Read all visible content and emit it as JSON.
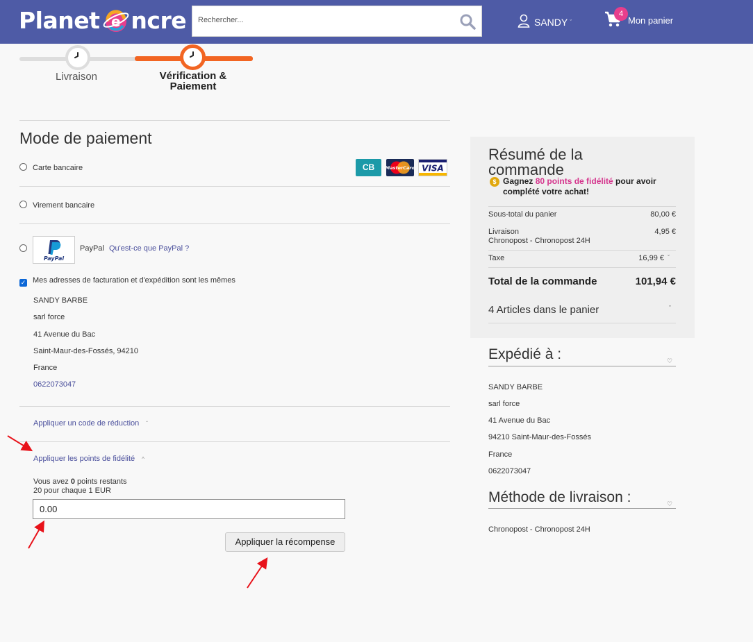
{
  "header": {
    "logo_text_left": "Planet",
    "logo_text_right": "ncre",
    "search_placeholder": "Rechercher...",
    "user_name": "SANDY",
    "user_caret": "ˇ",
    "cart_count": "4",
    "cart_label": "Mon panier",
    "colors": {
      "bar": "#4e5ba6",
      "badge": "#e83e8c"
    }
  },
  "steps": [
    {
      "label": "Livraison"
    },
    {
      "label": "Vérification & Paiement"
    }
  ],
  "payment": {
    "title": "Mode de paiement",
    "options": [
      "Carte bancaire",
      "Virement bancaire",
      "PayPal"
    ],
    "paypal_link": "Qu'est-ce que PayPal ?",
    "cards": [
      "CB",
      "MasterCard",
      "VISA"
    ],
    "same_address_label": "Mes adresses de facturation et d'expédition sont les mêmes",
    "same_address_checked": true
  },
  "billing_address": [
    "SANDY BARBE",
    "sarl force",
    "41 Avenue du Bac",
    "Saint-Maur-des-Fossés, 94210",
    "France",
    "0622073047"
  ],
  "discount": {
    "coupon_label": "Appliquer un code de réduction",
    "points_label": "Appliquer les points de fidélité",
    "points_prefix": "Vous avez ",
    "points_count": "0",
    "points_suffix": " points restants",
    "points_rate": "20 pour chaque 1 EUR",
    "points_value": "0.00",
    "apply_button": "Appliquer la récompense"
  },
  "summary": {
    "title": "Résumé de la commande",
    "fid_prefix": "Gagnez ",
    "fid_highlight": "80 points de fidélité",
    "fid_suffix": " pour avoir complété votre achat!",
    "subtotal_label": "Sous-total du panier",
    "subtotal_value": "80,00 €",
    "shipping_label": "Livraison",
    "shipping_carrier": "Chronopost - Chronopost 24H",
    "shipping_value": "4,95 €",
    "tax_label": "Taxe",
    "tax_value": "16,99 €",
    "total_label": "Total de la commande",
    "total_value": "101,94 €",
    "articles_label": "4 Articles dans le panier"
  },
  "shipped_to": {
    "title": "Expédié à :",
    "lines": [
      "SANDY BARBE",
      "sarl force",
      "41 Avenue du Bac",
      "94210 Saint-Maur-des-Fossés",
      "France",
      "0622073047"
    ]
  },
  "delivery_method": {
    "title": "Méthode de livraison :",
    "value": "Chronopost - Chronopost 24H"
  }
}
